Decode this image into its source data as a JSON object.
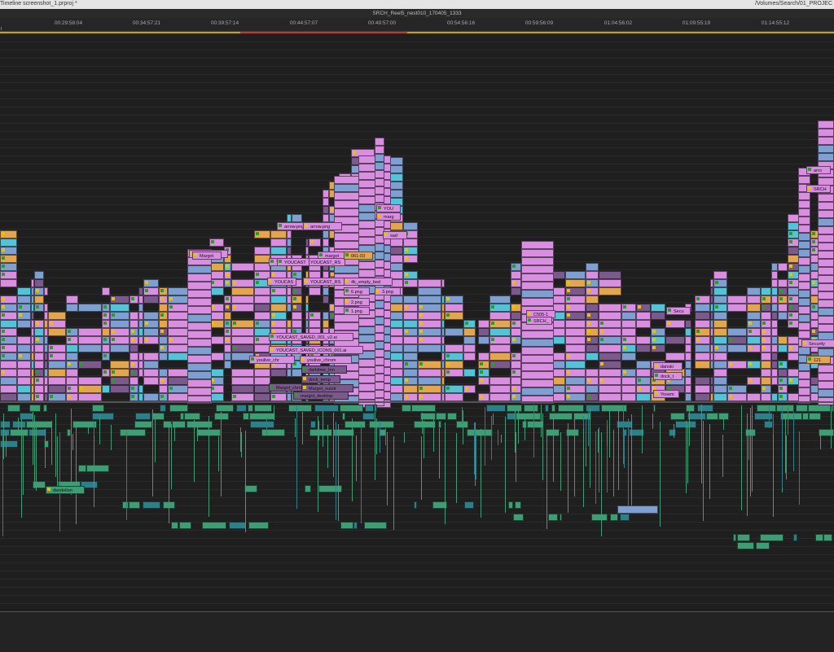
{
  "titlebar": {
    "title": "Timeline screenshot_1.prproj *",
    "path": "/Volumes/Search/01_PROJEC"
  },
  "sequence": {
    "name": "SRCH_Reel5_nest010_170405_1333"
  },
  "ruler": {
    "timecodes": [
      "00:29:58:04",
      "00:34:57:21",
      "00:39:57:14",
      "00:44:57:07",
      "00:49:57:00",
      "00:54:56:16",
      "00:59:56:09",
      "01:04:56:02",
      "01:09:55:19",
      "01:14:55:12"
    ]
  },
  "colors": {
    "pink": "#d98fe0",
    "blue": "#7f9fd0",
    "cyan": "#55c2d8",
    "orange": "#e2a650",
    "green_audio": "#3f9c74",
    "teal_audio": "#2f7f88",
    "mauve": "#7a5a8a",
    "label_green": "#2c9a2c",
    "label_yellow": "#e6c200"
  },
  "clips": [
    {
      "label": "arrow.png",
      "track": "V",
      "color": "pink"
    },
    {
      "label": "arrow.png",
      "track": "V",
      "color": "pink"
    },
    {
      "label": "arrow.png",
      "track": "V",
      "color": "pink"
    },
    {
      "label": "margot",
      "track": "V",
      "color": "pink"
    },
    {
      "label": "YOUCAS",
      "track": "V",
      "color": "pink"
    },
    {
      "label": "YOUCAST_RE",
      "track": "V",
      "color": "pink"
    },
    {
      "label": "YOUCAST_RS",
      "track": "V",
      "color": "pink"
    },
    {
      "label": "YOUCAST_RS",
      "track": "V",
      "color": "pink"
    },
    {
      "label": "4k_empty_bed",
      "track": "V",
      "color": "pink"
    },
    {
      "label": "6.png",
      "track": "V",
      "color": "pink"
    },
    {
      "label": "2.png",
      "track": "V",
      "color": "pink"
    },
    {
      "label": "1.png",
      "track": "V",
      "color": "pink"
    },
    {
      "label": "3.png",
      "track": "V",
      "color": "pink"
    },
    {
      "label": "YOUCAST_SAVED_001_v2.ai",
      "track": "V",
      "color": "pink"
    },
    {
      "label": "YOUCAST_SAVED_ICONS_001.ai",
      "track": "V",
      "color": "pink"
    },
    {
      "label": "youlive_chr",
      "track": "V",
      "color": "pink"
    },
    {
      "label": "youlive_chrom",
      "track": "V",
      "color": "pink"
    },
    {
      "label": "darktime_hm",
      "track": "V",
      "color": "mauve"
    },
    {
      "label": "dock_temp",
      "track": "V",
      "color": "mauve"
    },
    {
      "label": "Margot_chrom",
      "track": "V",
      "color": "mauve"
    },
    {
      "label": "Margot_outstr",
      "track": "V",
      "color": "mauve"
    },
    {
      "label": "margot_desktop",
      "track": "V",
      "color": "mauve"
    },
    {
      "label": "Margot",
      "track": "V",
      "color": "pink"
    },
    {
      "label": "YOUCAST",
      "track": "V",
      "color": "pink"
    },
    {
      "label": "sad",
      "track": "V",
      "color": "pink"
    },
    {
      "label": "YOU",
      "track": "V",
      "color": "pink"
    },
    {
      "label": "marg",
      "track": "V",
      "color": "pink"
    },
    {
      "label": "061-03",
      "track": "V",
      "color": "orange"
    },
    {
      "label": "C505-1",
      "track": "V",
      "color": "pink"
    },
    {
      "label": "SRCH_",
      "track": "V",
      "color": "pink"
    },
    {
      "label": "Security",
      "track": "V",
      "color": "pink"
    },
    {
      "label": "Secu",
      "track": "V",
      "color": "pink"
    },
    {
      "label": "danski",
      "track": "V",
      "color": "pink"
    },
    {
      "label": "dock_t",
      "track": "V",
      "color": "pink"
    },
    {
      "label": "Yosem",
      "track": "V",
      "color": "pink"
    },
    {
      "label": "arro",
      "track": "V",
      "color": "pink"
    },
    {
      "label": "SRCH",
      "track": "V",
      "color": "pink"
    },
    {
      "label": "121",
      "track": "V",
      "color": "orange"
    },
    {
      "label": "dandelion",
      "track": "A",
      "color": "green_audio"
    }
  ]
}
